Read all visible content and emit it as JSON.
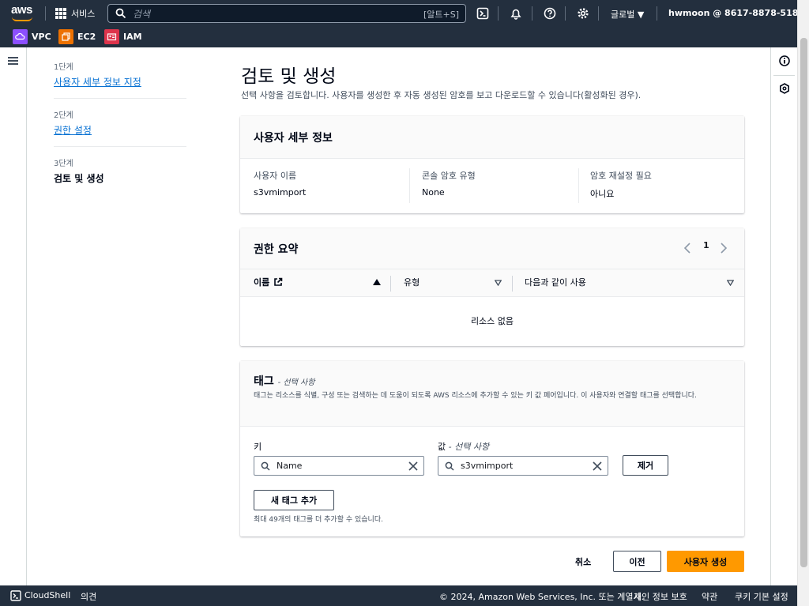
{
  "topnav": {
    "logo": "aws",
    "services": "서비스",
    "search_placeholder": "검색",
    "search_shortcut": "[알트+S]",
    "icons": [
      "cloudshell-icon",
      "bell-icon",
      "help-icon",
      "gear-icon"
    ],
    "region": "글로벌 ▼",
    "account": "hwmoon @ 8617-8878-5184 ▼"
  },
  "favorites": [
    {
      "label": "VPC",
      "color": "#8c4fff"
    },
    {
      "label": "EC2",
      "color": "#ed7100"
    },
    {
      "label": "IAM",
      "color": "#dd344c"
    }
  ],
  "steps": [
    {
      "num": "1단계",
      "label": "사용자 세부 정보 지정"
    },
    {
      "num": "2단계",
      "label": "권한 설정"
    },
    {
      "num": "3단계",
      "label": "검토 및 생성"
    }
  ],
  "page": {
    "title": "검토 및 생성",
    "subtitle": "선택 사항을 검토합니다. 사용자를 생성한 후 자동 생성된 암호를 보고 다운로드할 수 있습니다(활성화된 경우)."
  },
  "user_details": {
    "title": "사용자 세부 정보",
    "fields": [
      {
        "key": "사용자 이름",
        "value": "s3vmimport"
      },
      {
        "key": "콘솔 암호 유형",
        "value": "None"
      },
      {
        "key": "암호 재설정 필요",
        "value": "아니요"
      }
    ]
  },
  "permissions": {
    "title": "권한 요약",
    "page": "1",
    "columns": [
      "이름",
      "유형",
      "다음과 같이 사용"
    ],
    "empty": "리소스 없음"
  },
  "tags": {
    "title": "태그",
    "title_suffix": "- 선택 사항",
    "description": "태그는 리소스를 식별, 구성 또는 검색하는 데 도움이 되도록 AWS 리소스에 추가할 수 있는 키 값 페어입니다. 이 사용자와 연결할 태그를 선택합니다.",
    "key_label": "키",
    "value_label": "값",
    "value_label_suffix": "- 선택 사항",
    "key_value": "Name",
    "value_value": "s3vmimport",
    "remove": "제거",
    "add": "새 태그 추가",
    "hint": "최대 49개의 태그를 더 추가할 수 있습니다."
  },
  "actions": {
    "cancel": "취소",
    "prev": "이전",
    "create": "사용자 생성"
  },
  "footer": {
    "cloudshell": "CloudShell",
    "feedback": "의견",
    "copyright": "© 2024, Amazon Web Services, Inc. 또는 계열사.",
    "privacy": "개인 정보 보호",
    "terms": "약관",
    "cookies": "쿠키 기본 설정"
  }
}
